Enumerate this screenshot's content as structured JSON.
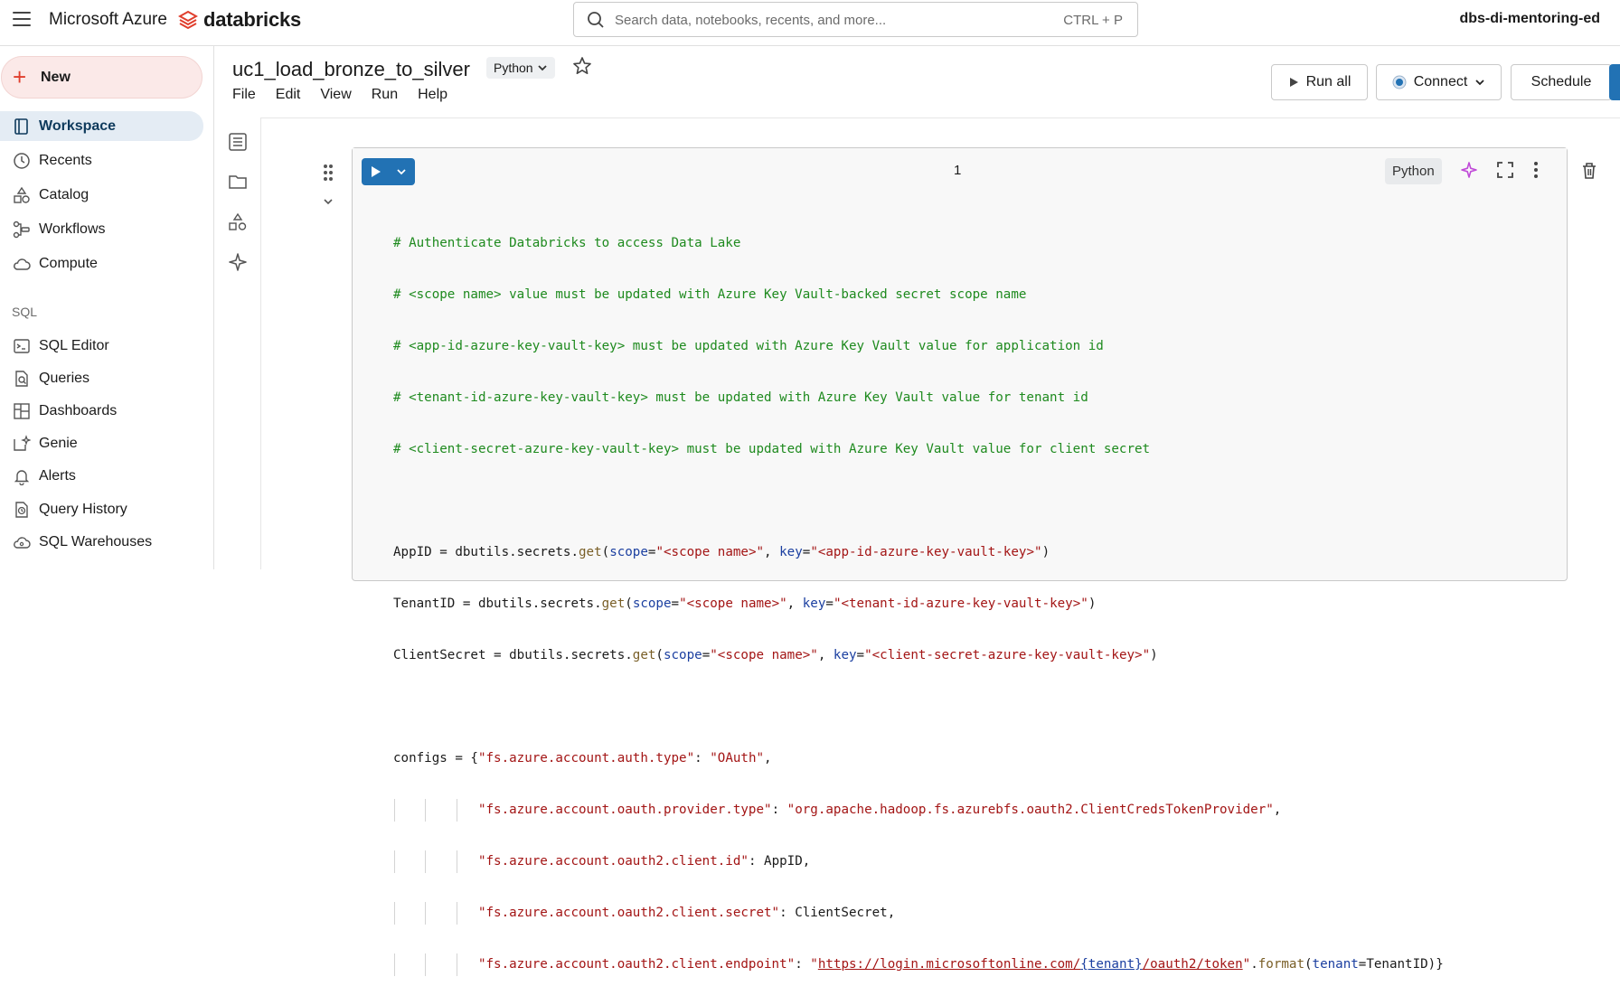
{
  "topbar": {
    "brand": "Microsoft Azure",
    "product": "databricks",
    "search_placeholder": "Search data, notebooks, recents, and more...",
    "search_shortcut": "CTRL + P",
    "workspace": "dbs-di-mentoring-ed"
  },
  "sidebar": {
    "new_label": "New",
    "items": [
      {
        "label": "Workspace",
        "icon": "workspace-icon",
        "active": true
      },
      {
        "label": "Recents",
        "icon": "clock-icon"
      },
      {
        "label": "Catalog",
        "icon": "catalog-icon"
      },
      {
        "label": "Workflows",
        "icon": "workflows-icon"
      },
      {
        "label": "Compute",
        "icon": "cloud-icon"
      }
    ],
    "sql_section": "SQL",
    "sql_items": [
      {
        "label": "SQL Editor",
        "icon": "sql-editor-icon"
      },
      {
        "label": "Queries",
        "icon": "queries-icon"
      },
      {
        "label": "Dashboards",
        "icon": "dashboards-icon"
      },
      {
        "label": "Genie",
        "icon": "genie-icon"
      },
      {
        "label": "Alerts",
        "icon": "bell-icon"
      },
      {
        "label": "Query History",
        "icon": "history-icon"
      },
      {
        "label": "SQL Warehouses",
        "icon": "warehouse-icon"
      }
    ]
  },
  "notebook": {
    "title": "uc1_load_bronze_to_silver",
    "language": "Python",
    "menu": [
      "File",
      "Edit",
      "View",
      "Run",
      "Help"
    ],
    "run_all": "Run all",
    "connect": "Connect",
    "schedule": "Schedule"
  },
  "cell": {
    "number": "1",
    "language": "Python",
    "code": {
      "c1": "# Authenticate Databricks to access Data Lake",
      "c2": "# <scope name> value must be updated with Azure Key Vault-backed secret scope name",
      "c3": "# <app-id-azure-key-vault-key> must be updated with Azure Key Vault value for application id",
      "c4": "# <tenant-id-azure-key-vault-key> must be updated with Azure Key Vault value for tenant id",
      "c5": "# <client-secret-azure-key-vault-key> must be updated with Azure Key Vault value for client secret",
      "appid_var": "AppID",
      "tenant_var": "TenantID",
      "secret_var": "ClientSecret",
      "dbutils": "dbutils.secrets.",
      "get": "get",
      "scope_kw": "scope",
      "key_kw": "key",
      "scope_val": "\"<scope name>\"",
      "app_key": "\"<app-id-azure-key-vault-key>\"",
      "tenant_key": "\"<tenant-id-azure-key-vault-key>\"",
      "secret_key": "\"<client-secret-azure-key-vault-key>\"",
      "configs_var": "configs",
      "k_auth_type": "\"fs.azure.account.auth.type\"",
      "v_auth_type": "\"OAuth\"",
      "k_provider": "\"fs.azure.account.oauth.provider.type\"",
      "v_provider": "\"org.apache.hadoop.fs.azurebfs.oauth2.ClientCredsTokenProvider\"",
      "k_client_id": "\"fs.azure.account.oauth2.client.id\"",
      "k_client_secret": "\"fs.azure.account.oauth2.client.secret\"",
      "k_endpoint": "\"fs.azure.account.oauth2.client.endpoint\"",
      "url_a": "https://login.microsoftonline.com/",
      "url_tenant": "{tenant}",
      "url_b": "/oauth2/token",
      "format": "format",
      "tenant_kw": "tenant"
    }
  }
}
